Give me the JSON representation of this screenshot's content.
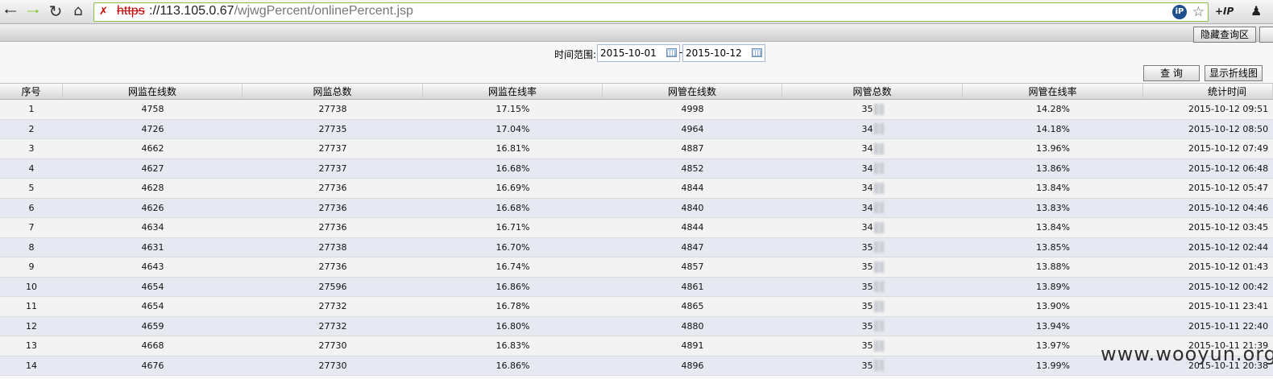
{
  "browser": {
    "url_scheme": "https",
    "url_rest": "://113.105.0.67",
    "url_path": "/wjwgPercent/onlinePercent.jsp",
    "ip_badge": "iP",
    "ext_ip_label": "+IP"
  },
  "header": {
    "hide_query_label": "隐藏查询区"
  },
  "filter": {
    "label": "时间范围:",
    "start_date": "2015-10-01",
    "end_date": "2015-10-12",
    "separator": "-",
    "query_label": "查 询",
    "show_chart_label": "显示折线图"
  },
  "table": {
    "columns": [
      "序号",
      "网监在线数",
      "网监总数",
      "网监在线率",
      "网管在线数",
      "网管总数",
      "网管在线率",
      "统计时间"
    ],
    "rows": [
      {
        "no": "1",
        "wj_online": "4758",
        "wj_total": "27738",
        "wj_rate": "17.15%",
        "wg_online": "4998",
        "wg_total": "35",
        "wg_rate": "14.28%",
        "time": "2015-10-12 09:51"
      },
      {
        "no": "2",
        "wj_online": "4726",
        "wj_total": "27735",
        "wj_rate": "17.04%",
        "wg_online": "4964",
        "wg_total": "34",
        "wg_rate": "14.18%",
        "time": "2015-10-12 08:50"
      },
      {
        "no": "3",
        "wj_online": "4662",
        "wj_total": "27737",
        "wj_rate": "16.81%",
        "wg_online": "4887",
        "wg_total": "34",
        "wg_rate": "13.96%",
        "time": "2015-10-12 07:49"
      },
      {
        "no": "4",
        "wj_online": "4627",
        "wj_total": "27737",
        "wj_rate": "16.68%",
        "wg_online": "4852",
        "wg_total": "34",
        "wg_rate": "13.86%",
        "time": "2015-10-12 06:48"
      },
      {
        "no": "5",
        "wj_online": "4628",
        "wj_total": "27736",
        "wj_rate": "16.69%",
        "wg_online": "4844",
        "wg_total": "34",
        "wg_rate": "13.84%",
        "time": "2015-10-12 05:47"
      },
      {
        "no": "6",
        "wj_online": "4626",
        "wj_total": "27736",
        "wj_rate": "16.68%",
        "wg_online": "4840",
        "wg_total": "34",
        "wg_rate": "13.83%",
        "time": "2015-10-12 04:46"
      },
      {
        "no": "7",
        "wj_online": "4634",
        "wj_total": "27736",
        "wj_rate": "16.71%",
        "wg_online": "4844",
        "wg_total": "34",
        "wg_rate": "13.84%",
        "time": "2015-10-12 03:45"
      },
      {
        "no": "8",
        "wj_online": "4631",
        "wj_total": "27738",
        "wj_rate": "16.70%",
        "wg_online": "4847",
        "wg_total": "35",
        "wg_rate": "13.85%",
        "time": "2015-10-12 02:44"
      },
      {
        "no": "9",
        "wj_online": "4643",
        "wj_total": "27736",
        "wj_rate": "16.74%",
        "wg_online": "4857",
        "wg_total": "35",
        "wg_rate": "13.88%",
        "time": "2015-10-12 01:43"
      },
      {
        "no": "10",
        "wj_online": "4654",
        "wj_total": "27596",
        "wj_rate": "16.86%",
        "wg_online": "4861",
        "wg_total": "35",
        "wg_rate": "13.89%",
        "time": "2015-10-12 00:42"
      },
      {
        "no": "11",
        "wj_online": "4654",
        "wj_total": "27732",
        "wj_rate": "16.78%",
        "wg_online": "4865",
        "wg_total": "35",
        "wg_rate": "13.90%",
        "time": "2015-10-11 23:41"
      },
      {
        "no": "12",
        "wj_online": "4659",
        "wj_total": "27732",
        "wj_rate": "16.80%",
        "wg_online": "4880",
        "wg_total": "35",
        "wg_rate": "13.94%",
        "time": "2015-10-11 22:40"
      },
      {
        "no": "13",
        "wj_online": "4668",
        "wj_total": "27730",
        "wj_rate": "16.83%",
        "wg_online": "4891",
        "wg_total": "35",
        "wg_rate": "13.97%",
        "time": "2015-10-11 21:39"
      },
      {
        "no": "14",
        "wj_online": "4676",
        "wj_total": "27730",
        "wj_rate": "16.86%",
        "wg_online": "4896",
        "wg_total": "35",
        "wg_rate": "13.99%",
        "time": "2015-10-11 20:38"
      }
    ]
  },
  "watermark": "www.wooyun.org"
}
